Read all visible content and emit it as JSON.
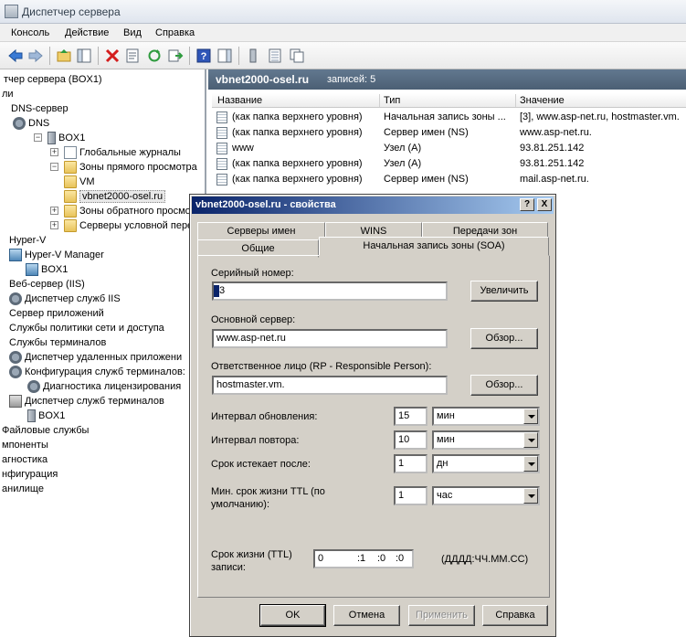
{
  "window": {
    "title": "Диспетчер сервера"
  },
  "menu": [
    "Консоль",
    "Действие",
    "Вид",
    "Справка"
  ],
  "toolbar_icons": [
    "back-icon",
    "forward-icon",
    "up-folder-icon",
    "show-hide-tree-icon",
    "delete-icon",
    "properties-icon",
    "refresh-icon",
    "export-icon",
    "help-icon",
    "show-pane-icon",
    "server-icon",
    "list-icon",
    "copy-icon"
  ],
  "tree": {
    "items": [
      {
        "label": "тчер сервера (BOX1)",
        "icon": "none"
      },
      {
        "label": "ли",
        "icon": "none"
      },
      {
        "label": "DNS-сервер",
        "icon": "none"
      },
      {
        "label": "DNS",
        "icon": "gear"
      },
      {
        "label": "BOX1",
        "icon": "server"
      },
      {
        "label": "Глобальные журналы",
        "icon": "doc"
      },
      {
        "label": "Зоны прямого просмотра",
        "icon": "folder"
      },
      {
        "label": "VM",
        "icon": "folder"
      },
      {
        "label": "vbnet2000-osel.ru",
        "icon": "folder"
      },
      {
        "label": "Зоны обратного просмотра",
        "icon": "folder"
      },
      {
        "label": "Серверы условной пересылки",
        "icon": "folder"
      },
      {
        "label": "Hyper-V",
        "icon": "none"
      },
      {
        "label": "Hyper-V Manager",
        "icon": "hv"
      },
      {
        "label": "BOX1",
        "icon": "hv"
      },
      {
        "label": "Веб-сервер (IIS)",
        "icon": "none"
      },
      {
        "label": "Диспетчер служб IIS",
        "icon": "gear"
      },
      {
        "label": "Сервер приложений",
        "icon": "none"
      },
      {
        "label": "Службы политики сети и доступа",
        "icon": "none"
      },
      {
        "label": "Службы терминалов",
        "icon": "none"
      },
      {
        "label": "Диспетчер удаленных приложени",
        "icon": "gear"
      },
      {
        "label": "Конфигурация служб терминалов:",
        "icon": "gear"
      },
      {
        "label": "Диагностика лицензирования",
        "icon": "gear"
      },
      {
        "label": "Диспетчер служб терминалов",
        "icon": "term"
      },
      {
        "label": "BOX1",
        "icon": "server"
      },
      {
        "label": "Файловые службы",
        "icon": "none"
      },
      {
        "label": "мпоненты",
        "icon": "none"
      },
      {
        "label": "агностика",
        "icon": "none"
      },
      {
        "label": "нфигурация",
        "icon": "none"
      },
      {
        "label": "анилище",
        "icon": "none"
      }
    ]
  },
  "zone_header": {
    "name": "vbnet2000-osel.ru",
    "records": "записей: 5"
  },
  "columns": [
    "Название",
    "Тип",
    "Значение"
  ],
  "records": [
    {
      "name": "(как папка верхнего уровня)",
      "type": "Начальная запись зоны ...",
      "value": "[3], www.asp-net.ru, hostmaster.vm."
    },
    {
      "name": "(как папка верхнего уровня)",
      "type": "Сервер имен (NS)",
      "value": "www.asp-net.ru."
    },
    {
      "name": "www",
      "type": "Узел (A)",
      "value": "93.81.251.142"
    },
    {
      "name": "(как папка верхнего уровня)",
      "type": "Узел (A)",
      "value": "93.81.251.142"
    },
    {
      "name": "(как папка верхнего уровня)",
      "type": "Сервер имен (NS)",
      "value": "mail.asp-net.ru."
    }
  ],
  "dialog": {
    "title": "vbnet2000-osel.ru - свойства",
    "help_btn": "?",
    "close_btn": "X",
    "tabs_top": [
      "Серверы имен",
      "WINS",
      "Передачи зон"
    ],
    "tabs_bottom": [
      "Общие",
      "Начальная запись зоны (SOA)"
    ],
    "serial_label": "Серийный номер:",
    "serial_value": "3",
    "increment_btn": "Увеличить",
    "primary_label": "Основной сервер:",
    "primary_value": "www.asp-net.ru",
    "browse_btn": "Обзор...",
    "responsible_label": "Ответственное лицо (RP - Responsible Person):",
    "responsible_value": "hostmaster.vm.",
    "browse_btn2": "Обзор...",
    "refresh_label": "Интервал обновления:",
    "refresh_value": "15",
    "refresh_unit": "мин",
    "retry_label": "Интервал повтора:",
    "retry_value": "10",
    "retry_unit": "мин",
    "expire_label": "Срок истекает после:",
    "expire_value": "1",
    "expire_unit": "дн",
    "minttl_label_1": "Мин. срок жизни TTL (по",
    "minttl_label_2": "умолчанию):",
    "minttl_value": "1",
    "minttl_unit": "час",
    "ttl_label_1": "Срок жизни (TTL)",
    "ttl_label_2": "записи:",
    "ttl_d": "0",
    "ttl_h": ":1",
    "ttl_m": ":0",
    "ttl_s": ":0",
    "ttl_format": "(ДДДД:ЧЧ.ММ.СС)",
    "ok_btn": "OK",
    "cancel_btn": "Отмена",
    "apply_btn": "Применить",
    "help_text_btn": "Справка"
  }
}
